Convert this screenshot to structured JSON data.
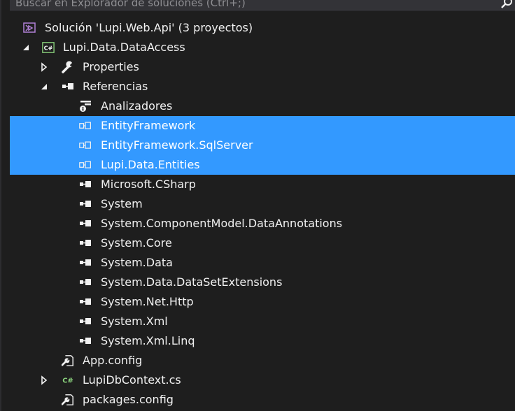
{
  "search": {
    "placeholder": "Buscar en Explorador de soluciones (Ctrl+;)"
  },
  "tree": {
    "solution": "Solución 'Lupi.Web.Api'  (3 proyectos)",
    "project": "Lupi.Data.DataAccess",
    "properties": "Properties",
    "references": "Referencias",
    "analyzers": "Analizadores",
    "ref_entityframework": "EntityFramework",
    "ref_entityframework_sqlserver": "EntityFramework.SqlServer",
    "ref_lupi_data_entities": "Lupi.Data.Entities",
    "ref_microsoft_csharp": "Microsoft.CSharp",
    "ref_system": "System",
    "ref_system_componentmodel": "System.ComponentModel.DataAnnotations",
    "ref_system_core": "System.Core",
    "ref_system_data": "System.Data",
    "ref_system_data_datasetext": "System.Data.DataSetExtensions",
    "ref_system_net_http": "System.Net.Http",
    "ref_system_xml": "System.Xml",
    "ref_system_xml_linq": "System.Xml.Linq",
    "app_config": "App.config",
    "lupi_db_context": "LupiDbContext.cs",
    "packages_config": "packages.config"
  },
  "icons": {
    "solution": "visual-studio-solution-icon",
    "project": "csharp-project-icon",
    "properties": "wrench-icon",
    "references": "reference-icon",
    "analyzers": "analyzer-icon",
    "assembly": "assembly-reference-icon",
    "config": "config-file-icon",
    "csharp_file": "csharp-file-icon"
  },
  "colors": {
    "background": "#1e1e1e",
    "selection": "#3399ff",
    "text": "#f1f1f1",
    "solution_icon": "#b180d7",
    "csharp_green": "#8bd37d"
  }
}
